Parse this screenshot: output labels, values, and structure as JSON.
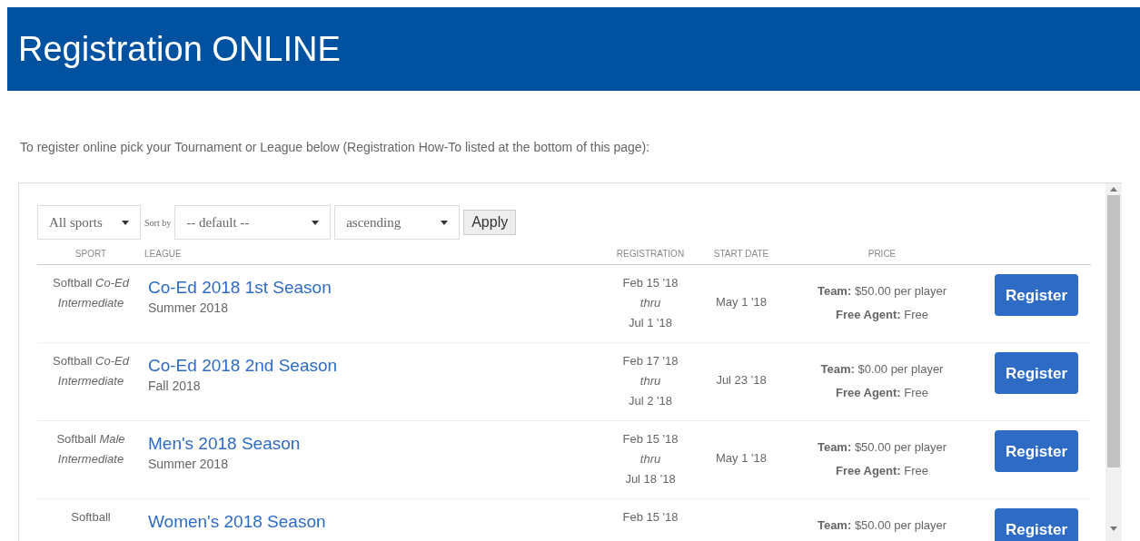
{
  "header": {
    "title": "Registration ONLINE"
  },
  "intro": "To register online pick your Tournament or League below (Registration How-To listed at the bottom of this page):",
  "filters": {
    "sport": "All sports",
    "sort_label": "Sort by",
    "sort": "-- default --",
    "order": "ascending",
    "apply": "Apply"
  },
  "table": {
    "columns": [
      "SPORT",
      "LEAGUE",
      "REGISTRATION",
      "START DATE",
      "PRICE"
    ],
    "rows": [
      {
        "sport": "Softball *Co-Ed* *Intermediate*",
        "league": "Co-Ed 2018 1st Season",
        "season": "Summer 2018",
        "reg_open": "Feb 15 '18",
        "reg_sep": "thru",
        "reg_close": "Jul 1 '18",
        "start": "May 1 '18",
        "team_price": "**Team:** $50.00 per player",
        "agent_price": "**Free Agent:** Free",
        "button": "Register"
      },
      {
        "sport": "Softball *Co-Ed* *Intermediate*",
        "league": "Co-Ed 2018 2nd Season",
        "season": "Fall 2018",
        "reg_open": "Feb 17 '18",
        "reg_sep": "thru",
        "reg_close": "Jul 2 '18",
        "start": "Jul 23 '18",
        "team_price": "**Team:** $0.00 per player",
        "agent_price": "**Free Agent:** Free",
        "button": "Register"
      },
      {
        "sport": "Softball *Male* *Intermediate*",
        "league": "Men's 2018 Season",
        "season": "Summer 2018",
        "reg_open": "Feb 15 '18",
        "reg_sep": "thru",
        "reg_close": "Jul 18 '18",
        "start": "May 1 '18",
        "team_price": "**Team:** $50.00 per player",
        "agent_price": "**Free Agent:** Free",
        "button": "Register"
      },
      {
        "sport": "Softball",
        "league": "Women's 2018 Season",
        "reg_open": "Feb 15 '18",
        "team_price": "**Team:** $50.00 per player",
        "button": "Register"
      }
    ]
  }
}
